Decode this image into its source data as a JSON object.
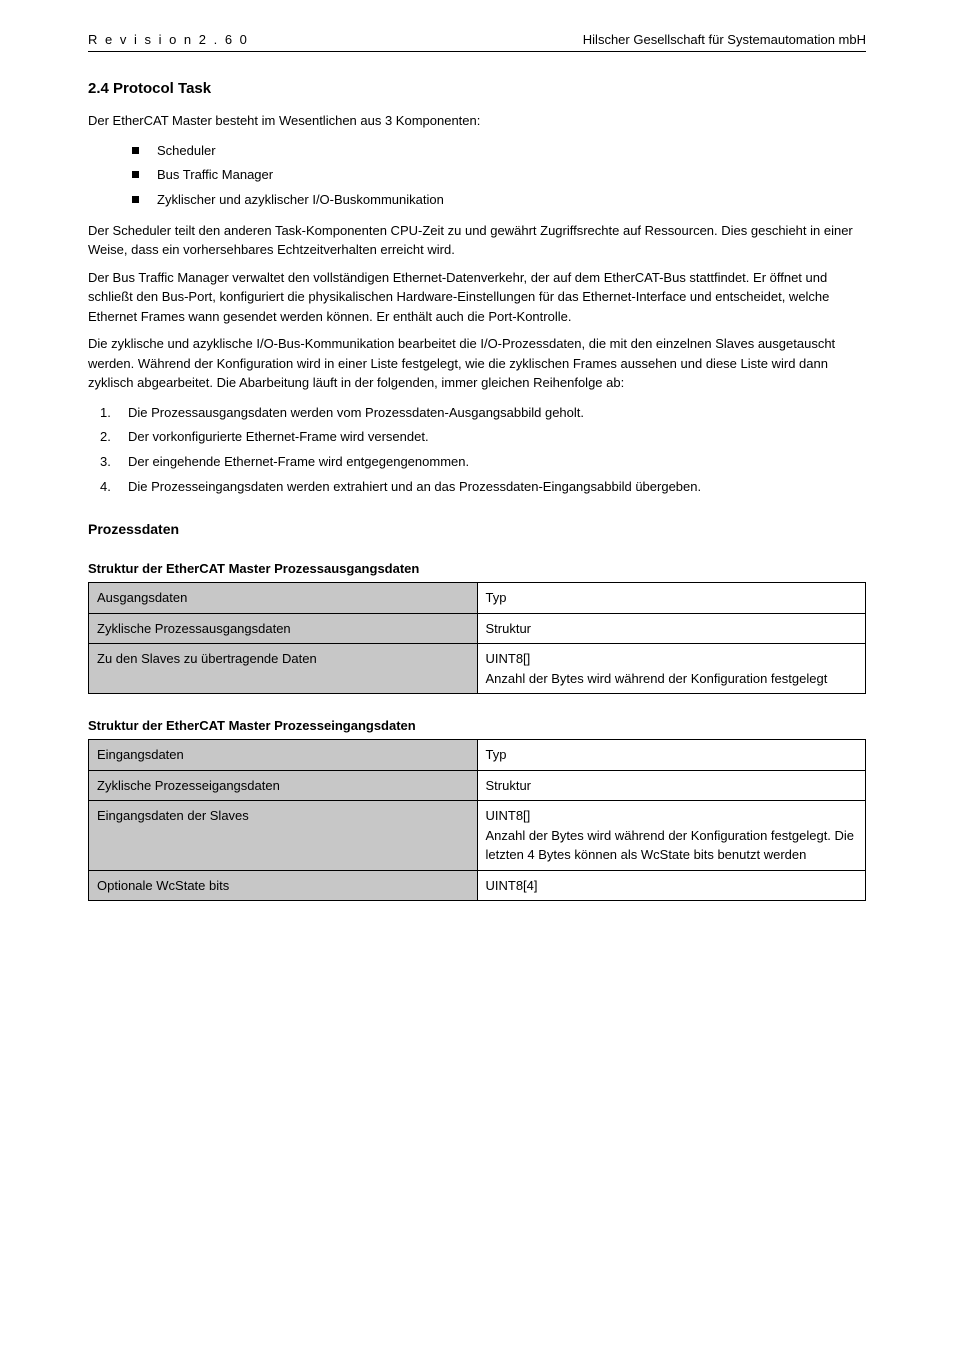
{
  "header": {
    "left": "R e v i s i o n 2 . 6 0",
    "right": "Hilscher Gesellschaft für Systemautomation mbH"
  },
  "sec_num_title": "2.4 Protocol Task",
  "para1": "Der EtherCAT Master besteht im Wesentlichen aus 3 Komponenten:",
  "bullets": [
    "Scheduler",
    "Bus Traffic Manager",
    "Zyklischer und azyklischer I/O-Buskommunikation"
  ],
  "para2": "Der Scheduler teilt den anderen Task-Komponenten CPU-Zeit zu und gewährt Zugriffsrechte auf Ressourcen. Dies geschieht in einer Weise, dass ein vorhersehbares Echtzeitverhalten erreicht wird.",
  "para3": "Der Bus Traffic Manager verwaltet den vollständigen Ethernet-Datenverkehr, der auf dem EtherCAT-Bus stattfindet. Er öffnet und schließt den Bus-Port, konfiguriert die physikalischen Hardware-Einstellungen für das Ethernet-Interface und entscheidet, welche Ethernet Frames wann gesendet werden können. Er enthält auch die Port-Kontrolle.",
  "para4": "Die zyklische und azyklische I/O-Bus-Kommunikation bearbeitet die I/O-Prozessdaten, die mit den einzelnen Slaves ausgetauscht werden. Während der Konfiguration wird in einer Liste festgelegt, wie die zyklischen Frames aussehen und diese Liste wird dann zyklisch abgearbeitet. Die Abarbeitung läuft in der folgenden, immer gleichen Reihenfolge ab:",
  "steps": [
    {
      "n": "1.",
      "t": "Die Prozessausgangsdaten werden vom Prozessdaten-Ausgangsabbild geholt."
    },
    {
      "n": "2.",
      "t": "Der vorkonfigurierte Ethernet-Frame wird versendet."
    },
    {
      "n": "3.",
      "t": "Der eingehende Ethernet-Frame wird entgegengenommen."
    },
    {
      "n": "4.",
      "t": "Die Prozesseingangsdaten werden extrahiert und an das Prozessdaten-Eingangsabbild übergeben."
    }
  ],
  "subhead1": "Prozessdaten",
  "table1_title": "Struktur der EtherCAT Master Prozessausgangsdaten",
  "t1": {
    "r1k": "Ausgangsdaten",
    "r1v": "Typ",
    "r2k": "Zyklische Prozessausgangsdaten",
    "r2v": "Struktur",
    "r3k": "Zu den Slaves zu übertragende Daten",
    "r3v": "UINT8[]\nAnzahl der Bytes wird während der Konfiguration festgelegt"
  },
  "table2_title": "Struktur der EtherCAT Master Prozesseingangsdaten",
  "t2": {
    "r1k": "Eingangsdaten",
    "r1v": "Typ",
    "r2k": "Zyklische Prozesseigangsdaten",
    "r2v": "Struktur",
    "r3k": "Eingangsdaten der Slaves",
    "r3v": "UINT8[]\nAnzahl der Bytes wird während der Konfiguration festgelegt. Die letzten 4 Bytes können als WcState bits benutzt werden",
    "r4k": "Optionale WcState bits",
    "r4v": "UINT8[4]"
  }
}
